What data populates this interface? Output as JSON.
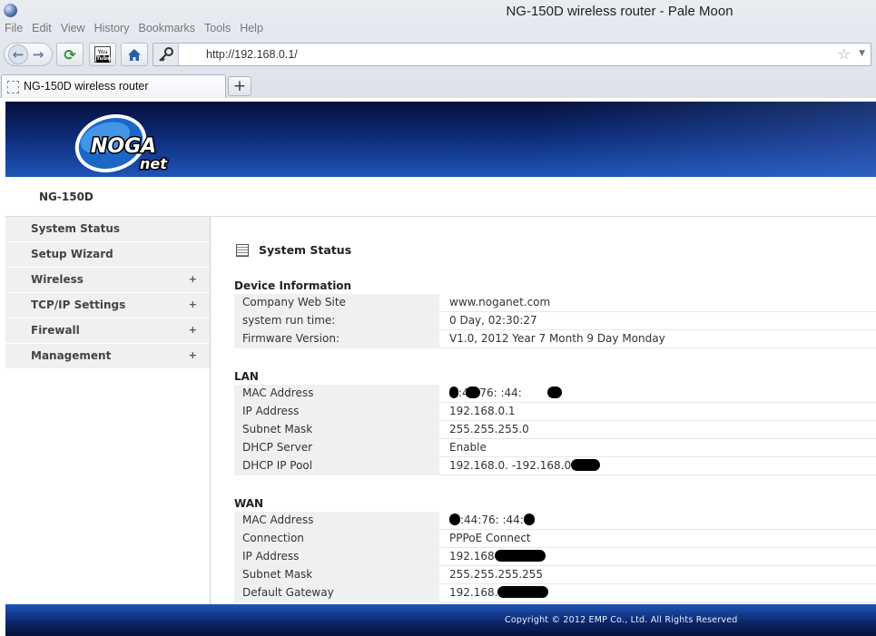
{
  "window": {
    "title": "NG-150D wireless router - Pale Moon"
  },
  "menu": [
    "File",
    "Edit",
    "View",
    "History",
    "Bookmarks",
    "Tools",
    "Help"
  ],
  "navbar": {
    "url": "http://192.168.0.1/",
    "youtube_text": "You",
    "youtube_text2": "Tube",
    "icons": [
      "back-icon",
      "forward-icon",
      "reload-icon",
      "youtube-icon",
      "home-icon",
      "key-icon",
      "star-icon",
      "dropdown-icon"
    ]
  },
  "tab": {
    "label": "NG-150D wireless router",
    "new_tab": "+"
  },
  "router": {
    "logo_top": "NOGA",
    "logo_bottom": "net",
    "model": "NG-150D",
    "sidebar": [
      {
        "label": "System Status",
        "expandable": false
      },
      {
        "label": "Setup Wizard",
        "expandable": false
      },
      {
        "label": "Wireless",
        "expandable": true
      },
      {
        "label": "TCP/IP Settings",
        "expandable": true
      },
      {
        "label": "Firewall",
        "expandable": true
      },
      {
        "label": "Management",
        "expandable": true
      }
    ],
    "plus": "+",
    "page_title": "System Status",
    "device": {
      "title": "Device Information",
      "rows": [
        {
          "label": "Company Web Site",
          "value": "www.noganet.com"
        },
        {
          "label": "system run time:",
          "value": "0 Day, 02:30:27"
        },
        {
          "label": "Firmware Version:",
          "value": "V1.0,  2012 Year 7 Month 9 Day Monday"
        }
      ]
    },
    "lan": {
      "title": "LAN",
      "rows": [
        {
          "label": "MAC Address",
          "value": ":44:76: :44:"
        },
        {
          "label": "IP Address",
          "value": "192.168.0.1"
        },
        {
          "label": "Subnet Mask",
          "value": "255.255.255.0"
        },
        {
          "label": "DHCP Server",
          "value": "Enable"
        },
        {
          "label": "DHCP IP Pool",
          "value": "192.168.0. -192.168.0."
        }
      ]
    },
    "wan": {
      "title": "WAN",
      "rows": [
        {
          "label": "MAC Address",
          "value": ":44:76: :44:"
        },
        {
          "label": "Connection",
          "value": "PPPoE Connect"
        },
        {
          "label": "IP Address",
          "value": "192.168"
        },
        {
          "label": "Subnet Mask",
          "value": "255.255.255.255"
        },
        {
          "label": "Default Gateway",
          "value": "192.168."
        }
      ]
    },
    "copyright": "Copyright © 2012 EMP Co., Ltd.   All Rights Reserved"
  },
  "colors": {
    "banner_dark": "#04103a",
    "banner_light": "#1e55b8",
    "sidebar_bg": "#f0f0f0"
  }
}
